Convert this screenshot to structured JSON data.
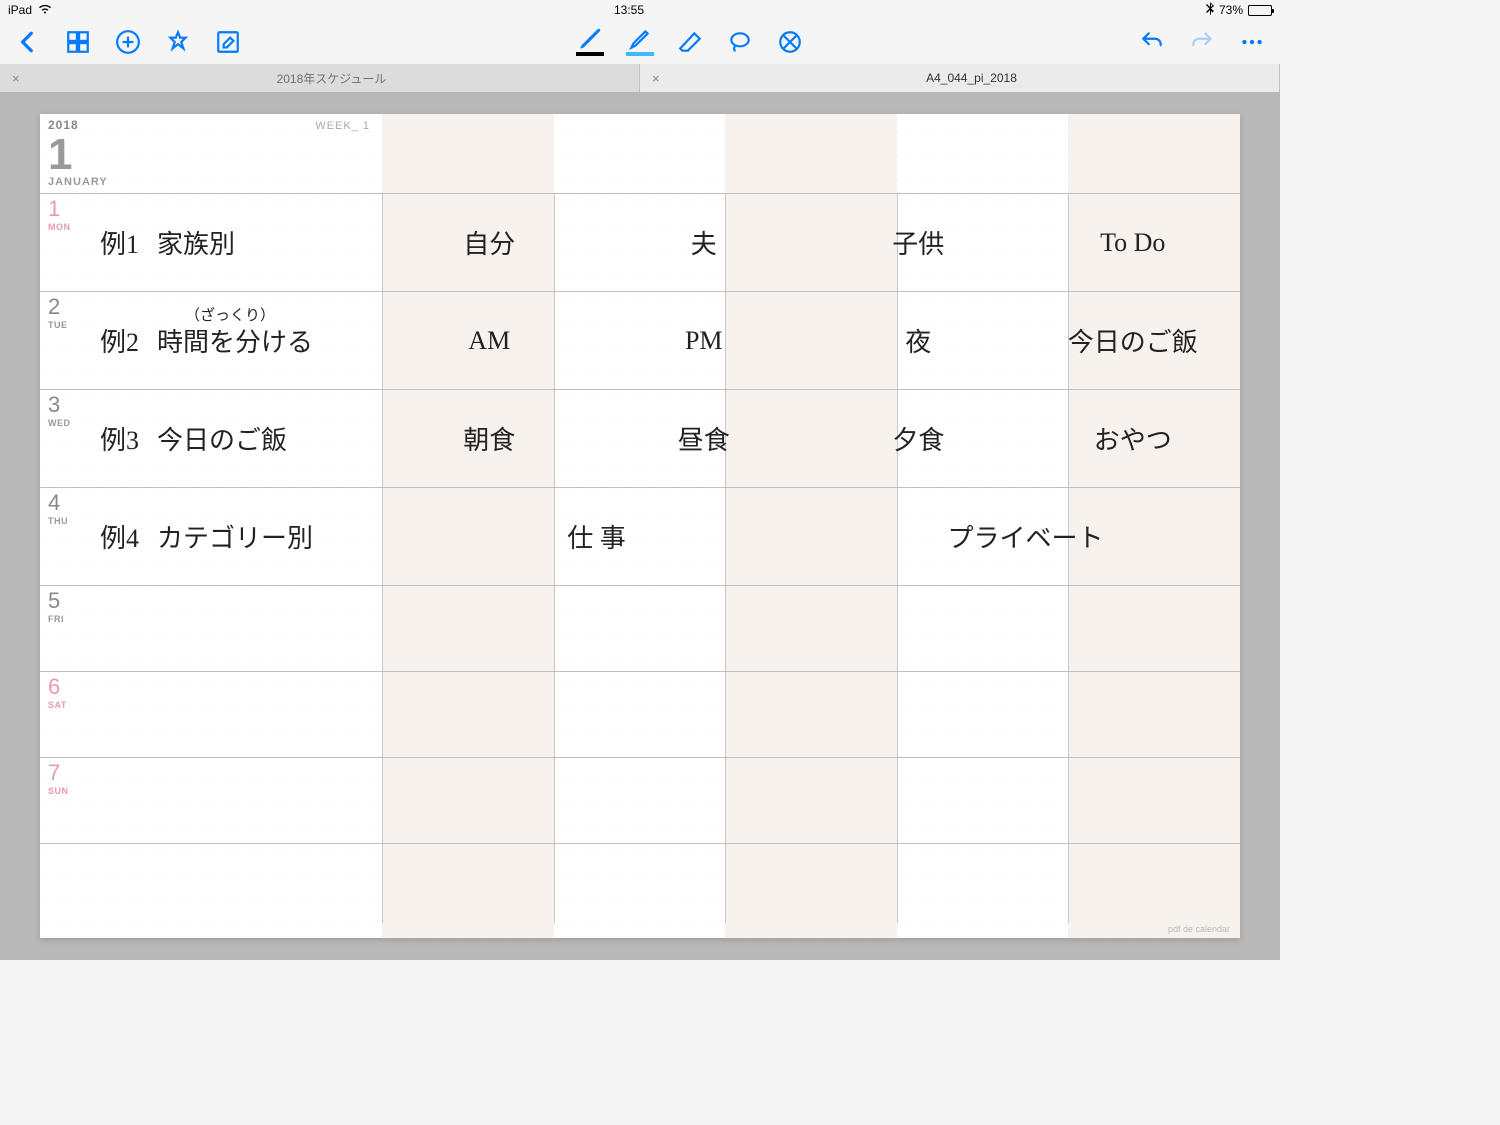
{
  "status": {
    "device": "iPad",
    "time": "13:55",
    "battery": "73%"
  },
  "tabs": {
    "active": "2018年スケジュール",
    "inactive": "A4_044_pi_2018"
  },
  "calendar": {
    "year": "2018",
    "month_num": "1",
    "month_name": "JANUARY",
    "week_label": "WEEK_  1",
    "footer": "pdf de calendar",
    "days": [
      {
        "num": "1",
        "abbr": "MON",
        "pink": true,
        "label_a": "例1",
        "label_b": "家族別",
        "cols": [
          "自分",
          "夫",
          "子供",
          "To Do"
        ]
      },
      {
        "num": "2",
        "abbr": "TUE",
        "pink": false,
        "label_a": "例2",
        "label_b": "時間を分ける",
        "annot": "（ざっくり）",
        "cols": [
          "AM",
          "PM",
          "夜",
          "今日のご飯"
        ]
      },
      {
        "num": "3",
        "abbr": "WED",
        "pink": false,
        "label_a": "例3",
        "label_b": "今日のご飯",
        "cols": [
          "朝食",
          "昼食",
          "夕食",
          "おやつ"
        ]
      },
      {
        "num": "4",
        "abbr": "THU",
        "pink": false,
        "label_a": "例4",
        "label_b": "カテゴリー別",
        "wide_cols": [
          "仕 事",
          "プライベート"
        ]
      },
      {
        "num": "5",
        "abbr": "FRI",
        "pink": false
      },
      {
        "num": "6",
        "abbr": "SAT",
        "pink": true
      },
      {
        "num": "7",
        "abbr": "SUN",
        "pink": true
      }
    ]
  }
}
